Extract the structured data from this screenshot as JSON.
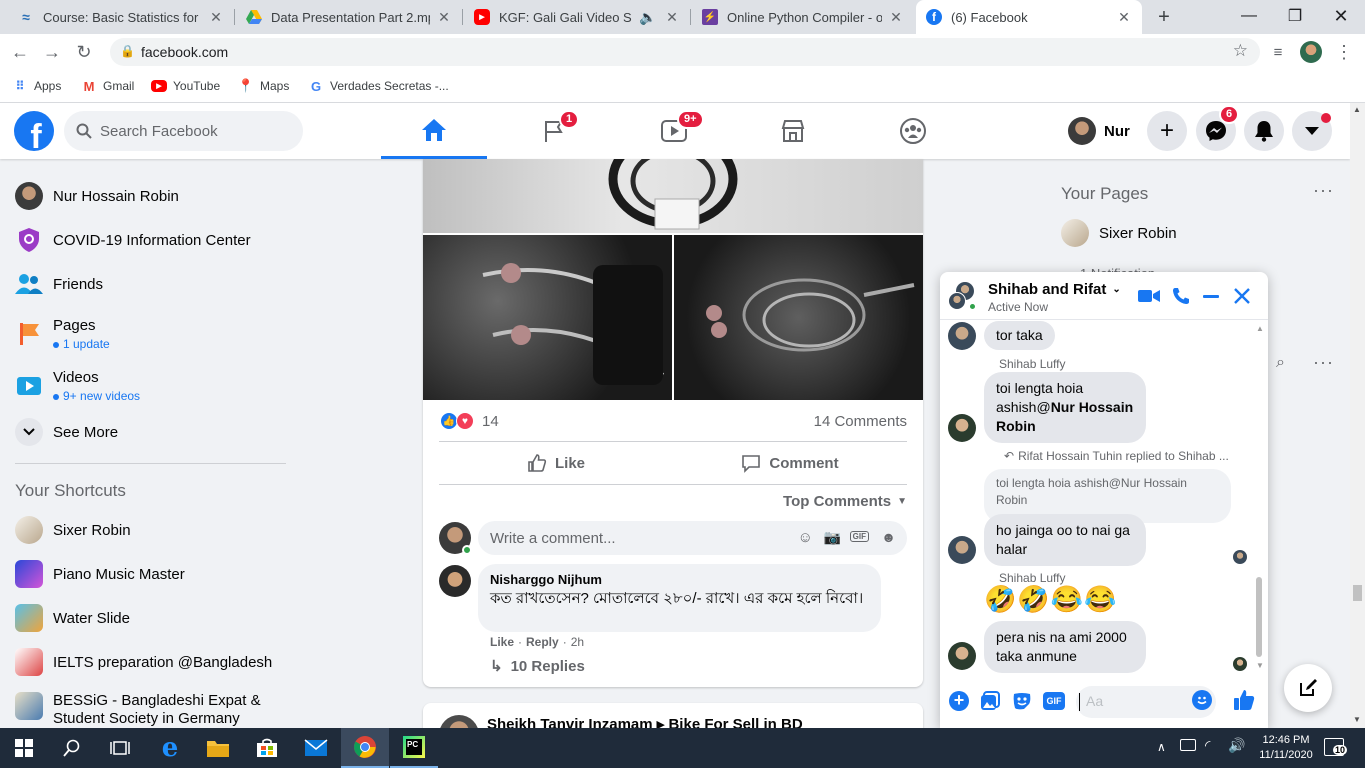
{
  "browser": {
    "tabs": [
      {
        "title": "Course: Basic Statistics for CSE",
        "favicon": "moodle-icon"
      },
      {
        "title": "Data Presentation Part 2.mp4 -",
        "favicon": "drive-icon"
      },
      {
        "title": "KGF: Gali Gali Video Song |",
        "favicon": "youtube-icon"
      },
      {
        "title": "Online Python Compiler - onlin",
        "favicon": "compiler-icon"
      },
      {
        "title": "(6) Facebook",
        "favicon": "facebook-icon"
      }
    ],
    "url": "facebook.com",
    "bookmarks": [
      {
        "label": "Apps"
      },
      {
        "label": "Gmail"
      },
      {
        "label": "YouTube"
      },
      {
        "label": "Maps"
      },
      {
        "label": "Verdades Secretas -..."
      }
    ]
  },
  "fb": {
    "search_placeholder": "Search Facebook",
    "nav_badges": {
      "pages": "1",
      "watch": "9+",
      "messenger": "6"
    },
    "user_short": "Nur",
    "brand_color": "#1877f2"
  },
  "sidebar": {
    "items": [
      {
        "label": "Nur Hossain Robin"
      },
      {
        "label": "COVID-19 Information Center"
      },
      {
        "label": "Friends"
      },
      {
        "label": "Pages",
        "sub": "1 update"
      },
      {
        "label": "Videos",
        "sub": "9+ new videos"
      },
      {
        "label": "See More"
      }
    ],
    "shortcuts_title": "Your Shortcuts",
    "shortcuts": [
      {
        "label": "Sixer Robin"
      },
      {
        "label": "Piano Music Master"
      },
      {
        "label": "Water Slide"
      },
      {
        "label": "IELTS preparation @Bangladesh"
      },
      {
        "label": "BESSiG - Bangladeshi Expat & Student Society in Germany"
      }
    ]
  },
  "post": {
    "reaction_count": "14",
    "comments_count": "14 Comments",
    "like_label": "Like",
    "comment_label": "Comment",
    "top_comments": "Top Comments",
    "write_placeholder": "Write a comment...",
    "comment": {
      "author": "Nisharggo Nijhum",
      "text": "কত রাখতেসেন? মোতালেবে ২৮০/- রাখে। এর কমে হলে নিবো।",
      "like": "Like",
      "reply": "Reply",
      "time": "2h",
      "replies": "10 Replies"
    },
    "next_post_header": "Sheikh Tanvir Inzamam ▸ Bike For Sell in BD"
  },
  "rightcol": {
    "your_pages": "Your Pages",
    "page_name": "Sixer Robin",
    "notification": "1 Notification"
  },
  "chat": {
    "title": "Shihab and Rifat",
    "status": "Active Now",
    "messages": {
      "m1": "tor taka",
      "sender1": "Shihab Luffy",
      "m2_line1": "toi lengta hoia",
      "m2_line2": "ashish@",
      "m2_bold": "Nur Hossain Robin",
      "reply_note": "Rifat Hossain Tuhin replied to Shihab ...",
      "quoted": "toi lengta hoia ashish@Nur Hossain Robin",
      "m3": "ho jainga oo to nai ga halar",
      "sender2": "Shihab Luffy",
      "emojis": "🤣🤣😂😂",
      "m4": "pera nis na ami 2000 taka anmune"
    },
    "input_placeholder": "Aa"
  },
  "taskbar": {
    "time": "12:46 PM",
    "date": "11/11/2020",
    "notifications": "10"
  }
}
